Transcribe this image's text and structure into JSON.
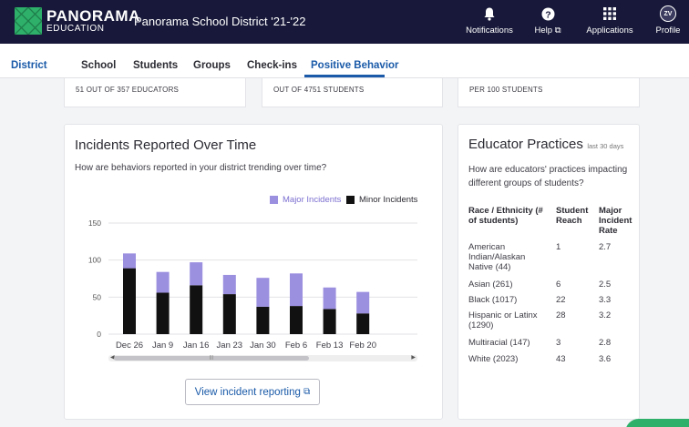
{
  "brand": {
    "name": "PANORAMA",
    "subname": "EDUCATION",
    "color": "#2eb06a"
  },
  "header": {
    "district": "Panorama School District '21-'22",
    "nav": [
      {
        "label": "Notifications",
        "icon": "bell-icon"
      },
      {
        "label": "Help",
        "icon": "help-icon"
      },
      {
        "label": "Applications",
        "icon": "grid-icon"
      },
      {
        "label": "Profile",
        "icon": "avatar",
        "initials": "ZV"
      }
    ]
  },
  "tabs": [
    "District",
    "School",
    "Students",
    "Groups",
    "Check-ins",
    "Positive Behavior"
  ],
  "active_tab": "Positive Behavior",
  "summary": [
    "51 OUT OF 357 EDUCATORS",
    "OUT OF 4751 STUDENTS",
    "PER 100 STUDENTS"
  ],
  "incidents": {
    "title": "Incidents Reported Over Time",
    "subtitle": "How are behaviors reported in your district trending over time?",
    "button": "View incident reporting"
  },
  "chart_data": {
    "type": "bar",
    "stacked": true,
    "categories": [
      "Dec 26",
      "Jan 9",
      "Jan 16",
      "Jan 23",
      "Jan 30",
      "Feb 6",
      "Feb 13",
      "Feb 20"
    ],
    "series": [
      {
        "name": "Minor Incidents",
        "color": "#111111",
        "values": [
          89,
          56,
          66,
          54,
          37,
          38,
          34,
          28
        ]
      },
      {
        "name": "Major Incidents",
        "color": "#9b8fe0",
        "values": [
          20,
          28,
          31,
          26,
          39,
          44,
          29,
          29
        ]
      }
    ],
    "ylim": [
      0,
      150
    ],
    "yticks": [
      0,
      50,
      100,
      150
    ],
    "legend": "top-right",
    "grid": true
  },
  "practices": {
    "title": "Educator Practices",
    "title_note": "last 30 days",
    "subtitle": "How are educators' practices impacting different groups of students?",
    "columns": [
      "Race / Ethnicity (# of students)",
      "Student Reach",
      "Major Incident Rate"
    ],
    "rows": [
      [
        "American Indian/Alaskan Native (44)",
        "1",
        "2.7"
      ],
      [
        "Asian (261)",
        "6",
        "2.5"
      ],
      [
        "Black (1017)",
        "22",
        "3.3"
      ],
      [
        "Hispanic or Latinx (1290)",
        "28",
        "3.2"
      ],
      [
        "Multiracial (147)",
        "3",
        "2.8"
      ],
      [
        "White (2023)",
        "43",
        "3.6"
      ]
    ]
  }
}
